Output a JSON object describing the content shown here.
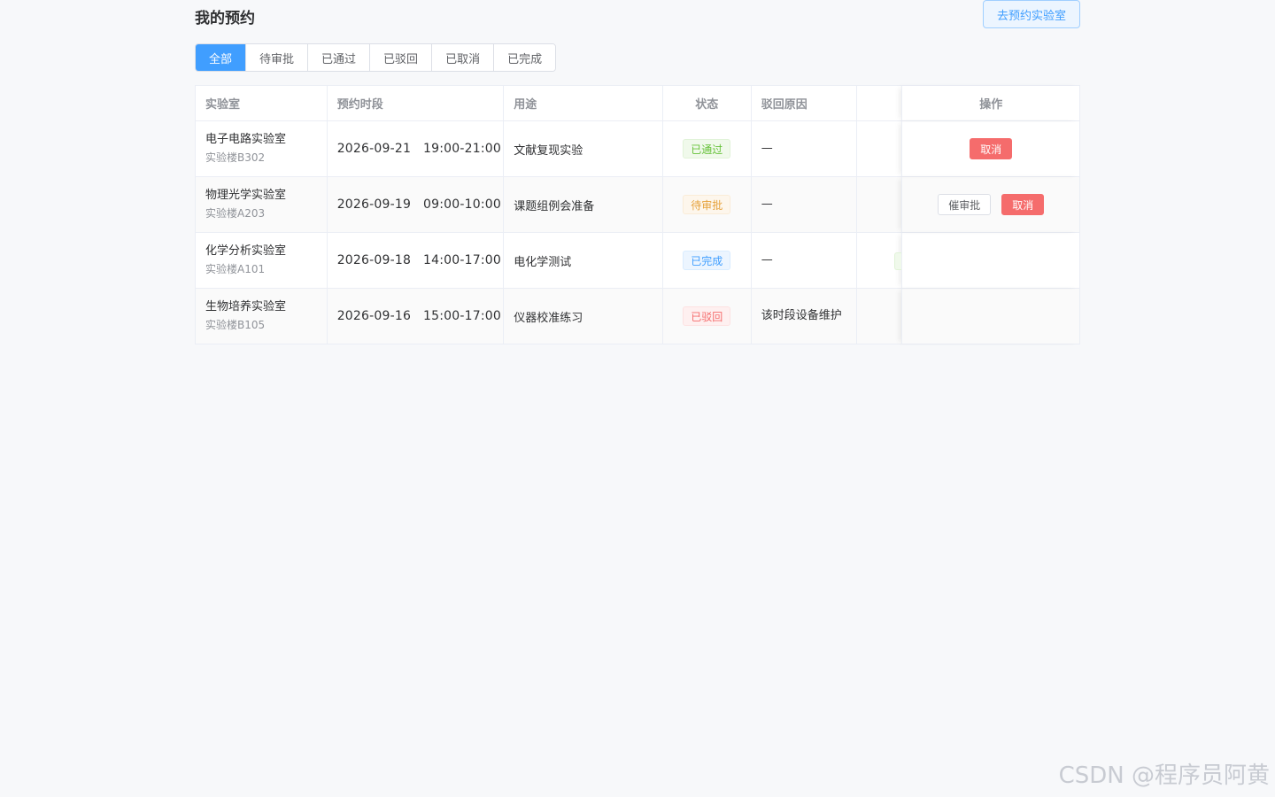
{
  "header": {
    "title": "我的预约",
    "book_button": "去预约实验室"
  },
  "tabs": [
    {
      "label": "全部",
      "active": true
    },
    {
      "label": "待审批",
      "active": false
    },
    {
      "label": "已通过",
      "active": false
    },
    {
      "label": "已驳回",
      "active": false
    },
    {
      "label": "已取消",
      "active": false
    },
    {
      "label": "已完成",
      "active": false
    }
  ],
  "table": {
    "columns": {
      "lab": "实验室",
      "time": "预约时段",
      "use": "用途",
      "status": "状态",
      "reason": "驳回原因",
      "ops": "操作"
    },
    "rows": [
      {
        "lab_name": "电子电路实验室",
        "lab_location": "实验楼B302",
        "time": "2026-09-21   19:00-21:00",
        "use": "文献复现实验",
        "status": "已通过",
        "reason": "—",
        "actions": [
          "取消"
        ]
      },
      {
        "lab_name": "物理光学实验室",
        "lab_location": "实验楼A203",
        "time": "2026-09-19   09:00-10:00",
        "use": "课题组例会准备",
        "status": "待审批",
        "reason": "—",
        "actions": [
          "催审批",
          "取消"
        ]
      },
      {
        "lab_name": "化学分析实验室",
        "lab_location": "实验楼A101",
        "time": "2026-09-18   14:00-17:00",
        "use": "电化学测试",
        "status": "已完成",
        "reason": "—",
        "actions": []
      },
      {
        "lab_name": "生物培养实验室",
        "lab_location": "实验楼B105",
        "time": "2026-09-16   15:00-17:00",
        "use": "仪器校准练习",
        "status": "已驳回",
        "reason": "该时段设备维护",
        "actions": []
      }
    ]
  },
  "watermark": "CSDN @程序员阿黄",
  "colors": {
    "primary": "#409eff",
    "success": "#67c23a",
    "warning": "#e6a23c",
    "danger": "#f56c6c"
  }
}
